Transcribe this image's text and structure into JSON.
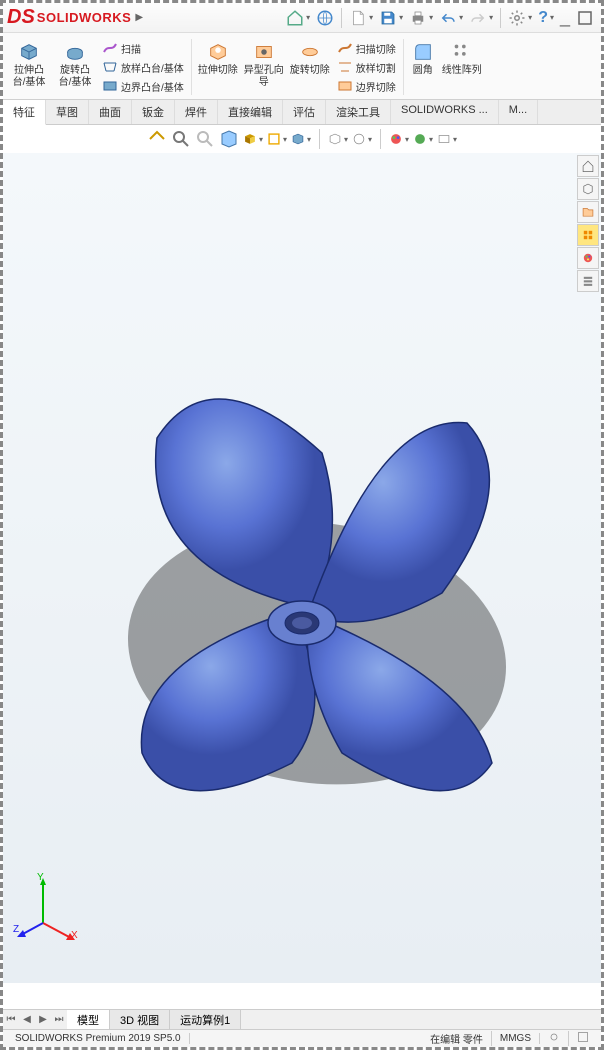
{
  "logo_text": "SOLIDWORKS",
  "titlebar_icons": [
    "home",
    "web",
    "file-new",
    "save",
    "print",
    "undo",
    "redo",
    "settings",
    "help"
  ],
  "ribbon": {
    "g1": {
      "extrude_boss": "拉伸凸台/基体",
      "revolve_boss": "旋转凸台/基体",
      "sweep": "扫描",
      "loft": "放样凸台/基体",
      "boundary": "边界凸台/基体"
    },
    "g2": {
      "extrude_cut": "拉伸切除",
      "hole": "异型孔向导",
      "revolve_cut": "旋转切除",
      "sweep_cut": "扫描切除",
      "loft_cut": "放样切割",
      "boundary_cut": "边界切除"
    },
    "g3": {
      "fillet": "圆角",
      "pattern": "线性阵列"
    }
  },
  "tabs": [
    "特征",
    "草图",
    "曲面",
    "钣金",
    "焊件",
    "直接编辑",
    "评估",
    "渲染工具",
    "SOLIDWORKS ...",
    "M..."
  ],
  "active_tab": 0,
  "bottom_tabs": [
    "模型",
    "3D 视图",
    "运动算例1"
  ],
  "status": {
    "version": "SOLIDWORKS Premium 2019 SP5.0",
    "mode": "在编辑 零件",
    "units": "MMGS"
  },
  "triad": {
    "x": "X",
    "y": "Y",
    "z": "Z"
  }
}
